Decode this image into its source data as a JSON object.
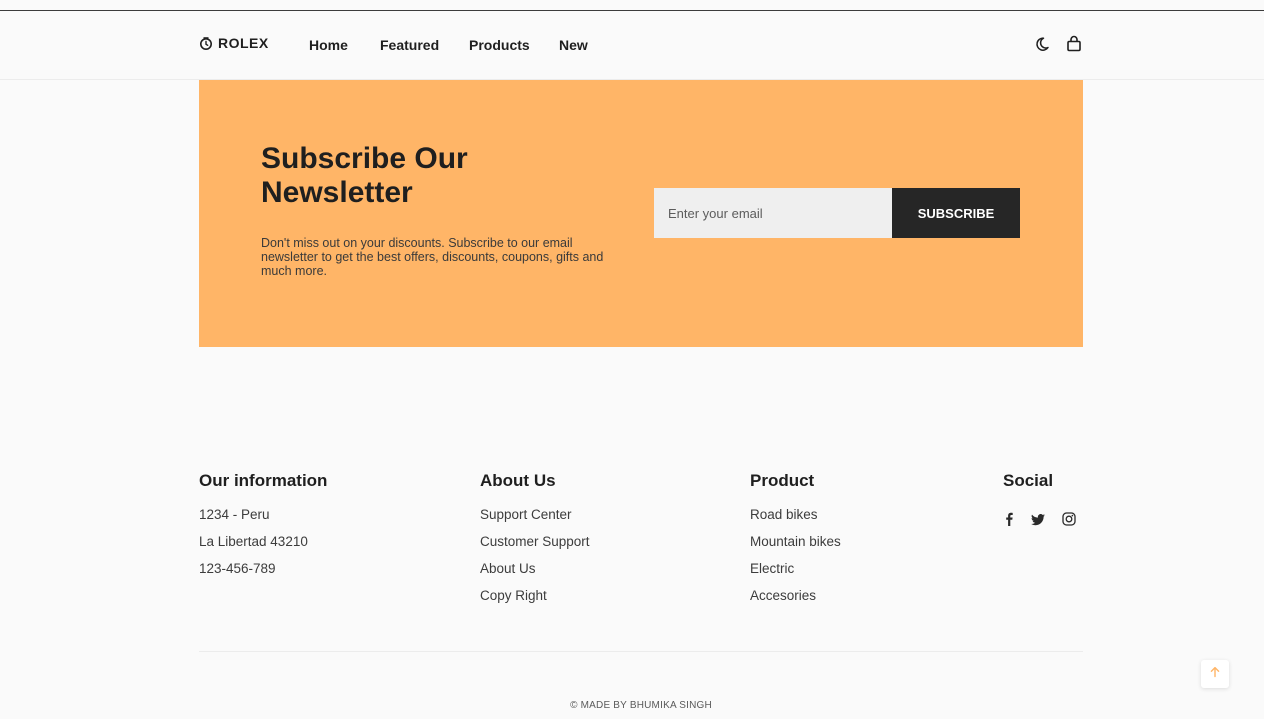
{
  "header": {
    "brand": "ROLEX",
    "nav": [
      "Home",
      "Featured",
      "Products",
      "New"
    ],
    "icons": [
      "moon-icon",
      "shopping-bag-icon"
    ]
  },
  "newsletter": {
    "title": "Subscribe Our Newsletter",
    "description": "Don't miss out on your discounts. Subscribe to our email newsletter to get the best offers, discounts, coupons, gifts and much more.",
    "email_placeholder": "Enter your email",
    "button_label": "SUBSCRIBE",
    "background_color": "#ffb567",
    "button_color": "#262626"
  },
  "footer": {
    "info": {
      "heading": "Our information",
      "lines": [
        "1234 - Peru",
        "La Libertad 43210",
        "123-456-789"
      ]
    },
    "about": {
      "heading": "About Us",
      "links": [
        "Support Center",
        "Customer Support",
        "About Us",
        "Copy Right"
      ]
    },
    "product": {
      "heading": "Product",
      "links": [
        "Road bikes",
        "Mountain bikes",
        "Electric",
        "Accesories"
      ]
    },
    "social": {
      "heading": "Social",
      "icons": [
        "facebook-icon",
        "twitter-icon",
        "instagram-icon"
      ]
    },
    "copyright": "© MADE BY BHUMIKA SINGH"
  },
  "scroll_top": {
    "icon": "arrow-up-icon",
    "accent_color": "#ffb567"
  }
}
